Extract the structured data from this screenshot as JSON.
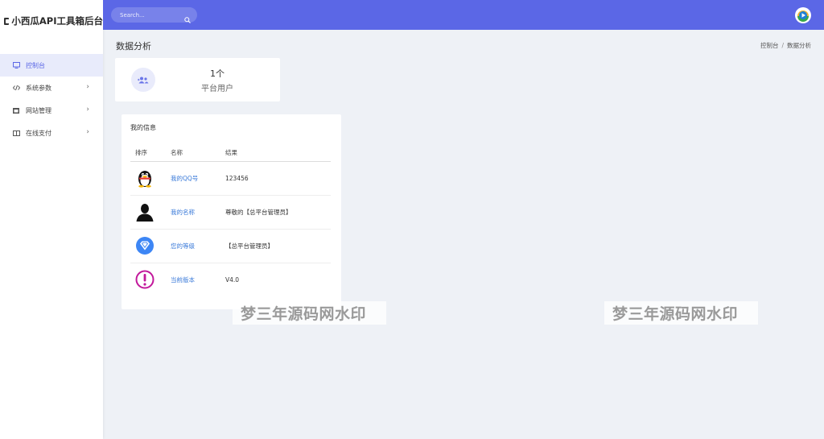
{
  "brand": {
    "title": "小西瓜API工具箱后台",
    "icon": "square-logo-icon"
  },
  "sidebar": {
    "items": [
      {
        "label": "控制台",
        "icon": "monitor-icon",
        "active": true,
        "has_children": false
      },
      {
        "label": "系统参数",
        "icon": "code-icon",
        "active": false,
        "has_children": true
      },
      {
        "label": "网站管理",
        "icon": "window-icon",
        "active": false,
        "has_children": true
      },
      {
        "label": "在线支付",
        "icon": "book-icon",
        "active": false,
        "has_children": true
      }
    ]
  },
  "topbar": {
    "search_placeholder": "Search...",
    "accent_color": "#5b67e6"
  },
  "page": {
    "title": "数据分析",
    "breadcrumb": {
      "home": "控制台",
      "separator": "/",
      "current": "数据分析"
    }
  },
  "stat": {
    "value": "1个",
    "label": "平台用户",
    "icon": "users-icon"
  },
  "info": {
    "title": "我的信息",
    "columns": {
      "seq": "排序",
      "name": "名称",
      "result": "结果"
    },
    "rows": [
      {
        "icon": "qq-penguin-icon",
        "name": "我的QQ号",
        "value": "123456"
      },
      {
        "icon": "person-silhouette-icon",
        "name": "我的名称",
        "value": "尊敬的【总平台管理员】"
      },
      {
        "icon": "vip-diamond-icon",
        "name": "您的等级",
        "value": "【总平台管理员】"
      },
      {
        "icon": "exclamation-circle-icon",
        "name": "当前版本",
        "value": "V4.0"
      }
    ]
  },
  "watermarks": [
    "梦三年源码网水印",
    "梦三年源码网水印"
  ]
}
